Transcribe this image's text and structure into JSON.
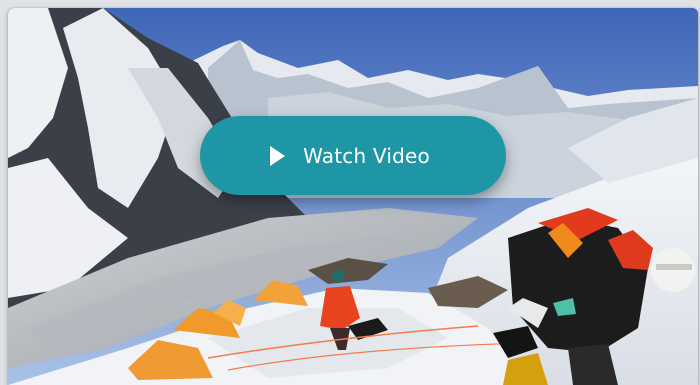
{
  "video": {
    "watch_label": "Watch Video",
    "play_icon": "play-icon",
    "accent_color": "#1f96a6"
  }
}
